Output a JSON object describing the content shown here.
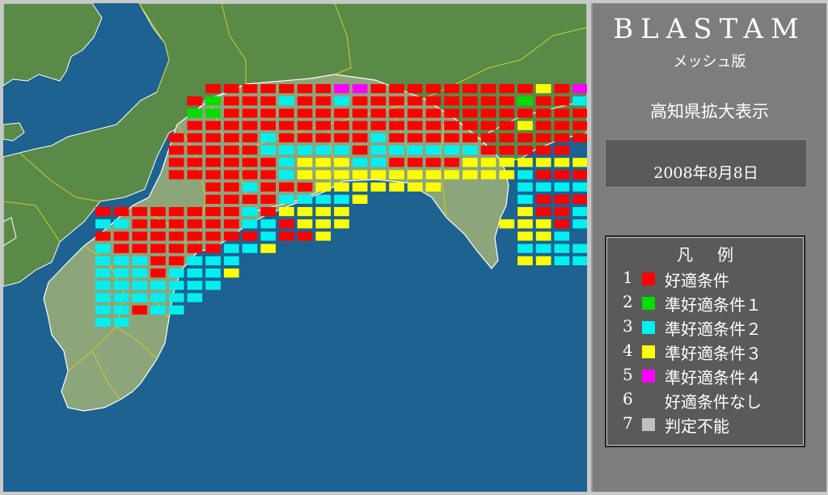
{
  "app": {
    "title": "BLASTAM",
    "subtitle": "メッシュ版",
    "region": "高知県拡大表示",
    "date": "2008年8月8日"
  },
  "colors": {
    "sea": "#1d6291",
    "land_other": "#5a8a47",
    "land_kochi": "#8ca57a",
    "border": "#d4c930",
    "coast": "#ffffff"
  },
  "legend": {
    "title": "凡例",
    "items": [
      {
        "num": "1",
        "color": "#ff0000",
        "label": "好適条件"
      },
      {
        "num": "2",
        "color": "#00dd00",
        "label": "準好適条件１"
      },
      {
        "num": "3",
        "color": "#00f0f0",
        "label": "準好適条件２"
      },
      {
        "num": "4",
        "color": "#ffff00",
        "label": "準好適条件３"
      },
      {
        "num": "5",
        "color": "#ff00ff",
        "label": "準好適条件４"
      },
      {
        "num": "6",
        "color": "",
        "label": "好適条件なし"
      },
      {
        "num": "7",
        "color": "#c0c0c0",
        "label": "判定不能"
      }
    ]
  },
  "mesh": {
    "grid": {
      "cols": 30,
      "rows": 19
    },
    "rows": [
      "......RRRRRRRMMRRRRRRRRRYRMY..",
      ".....RGRRRCRRCRRRRRRRRRGRRC...",
      ".....GGRRRRRRRRRRRRRRRRRRRRRR.",
      ".....RRRRRRRRRRRRRRRRRRYRRRRM.",
      "....RRRRRCRRRRRCRRRRRRRRRRRR..",
      "....RRRRRCCCCCRCCCCCCRRRRR....",
      "....RRRRRRCYYYCCRRRRYYYYYYYRY.",
      "....RRRRRRCYYYYYYYYYYYYCRRRRRC",
      "......RRCRRRYYYYYYY....CCCCC..",
      "......RRRRCCCCY........CRRRRR.",
      "RRRRRRRRCRYYYY.........YRRCR..",
      "CCRRRRRRCCRYYY........YYYRCR..",
      "RRRRRRRRRCRRY..........YYC....",
      "CRRRRRRCCY.............CCCC...",
      "CCCRRCCC...............YYCC...",
      "CCCRCCCY......................",
      "CCCCCCC.......................",
      "CCCCCC........................",
      "CCRCC.........................",
      "CC............................"
    ]
  }
}
